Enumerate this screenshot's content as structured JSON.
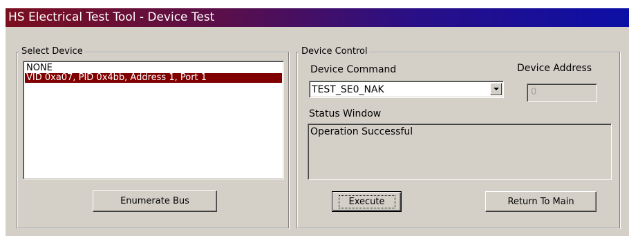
{
  "window": {
    "title": "HS Electrical Test Tool - Device Test"
  },
  "select_device": {
    "group_title": "Select Device",
    "items": [
      {
        "label": "NONE",
        "selected": false
      },
      {
        "label": "VID 0xa07, PID 0x4bb, Address 1, Port 1",
        "selected": true
      }
    ],
    "enumerate_label": "Enumerate Bus"
  },
  "device_control": {
    "group_title": "Device Control",
    "command_label": "Device Command",
    "command_value": "TEST_SE0_NAK",
    "address_label": "Device Address",
    "address_value": "0",
    "status_label": "Status Window",
    "status_text": "Operation Successful",
    "execute_label": "Execute",
    "return_label": "Return To Main"
  },
  "colors": {
    "selection": "#800000",
    "title_start": "#7a0f1e",
    "title_end": "#0c0fa6",
    "face": "#d4d0c8"
  },
  "icons": {
    "combo_dropdown": "chevron-down-icon"
  }
}
